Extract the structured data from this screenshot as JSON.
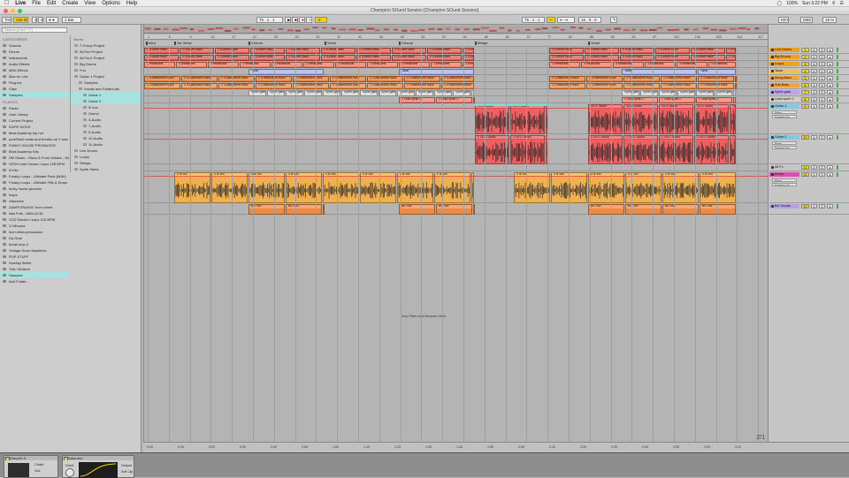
{
  "menubar": {
    "app": "Live",
    "items": [
      "File",
      "Edit",
      "Create",
      "View",
      "Options",
      "Help"
    ],
    "battery": "100%",
    "clock": "Sun 3:22 PM"
  },
  "window": {
    "title": "Champion SOund Session  [Champion SOund Session]"
  },
  "transport": {
    "tap": "TAP",
    "tempo": "150.00",
    "meter_a": "4",
    "meter_b": "4",
    "quantize": "1 Bar",
    "position": "75 .  1 .  1",
    "loop_start": "75 .  1 .  1",
    "loop_length": "16 .  0 .  0",
    "key": "KEY",
    "midi": "MIDI",
    "cpu": "19 %"
  },
  "browser": {
    "search_placeholder": "Search (Cmd + F)",
    "categories_header": "CATEGORIES",
    "categories": [
      "Sounds",
      "Drums",
      "Instruments",
      "Audio Effects",
      "MIDI Effects",
      "Max for Live",
      "Plug-ins",
      "Clips",
      "Samples"
    ],
    "places_header": "PLACES",
    "places": [
      "Packs",
      "User Library",
      "Current Project",
      "DOPE KICKS",
      "Beat Academy hip hot",
      "pureSteel beats and breaks vol 1 wav",
      "FUNKY HOUSE PRODUCER",
      "Beat Academy Kits",
      "SM Studio - Disco & Funk Guitars - WAV",
      "VESH Latin House Loops 128 BPM",
      "Ill Kitz",
      "Freaky Loops - Ultimate Pack [WAV]",
      "Freaky Loops - Ultimate Fills & Drops",
      "funky house grooves",
      "loops",
      "villacorbe",
      "ZAMPLEMASIC from robert",
      "Nas Folk - WAV-ACID",
      "VOZ Electric Loops 120 BPM",
      "G Minuma",
      "tech vibes percussion",
      "Da Grail",
      "break loop 3",
      "Vintage Drum Machines",
      "POP STUFF",
      "Sunday Skillet",
      "This I Believe",
      "Samples",
      "Add Folder..."
    ],
    "files_header": "Name",
    "files": [
      "7-Group Project",
      "All Fun Project",
      "All Fun1 Project",
      "Big Drums",
      "Fun",
      "Guitar 1 Project",
      "Samples",
      "Vocals and Guitars.als",
      "Guitar 1",
      "Guitar 2",
      "Ill Vox",
      "Outro1",
      "4-Audio",
      "7-Audio",
      "9-Audio",
      "10-Audio",
      "11-Audio",
      "Live Drums",
      "Loops",
      "Strings",
      "Synth Stabs"
    ]
  },
  "arrangement": {
    "ruler": [
      "1",
      "5",
      "9",
      "13",
      "17",
      "21",
      "25",
      "29",
      "33",
      "37",
      "41",
      "45",
      "49",
      "53",
      "57",
      "61",
      "65",
      "69",
      "73",
      "77",
      "81",
      "85",
      "89",
      "93",
      "97",
      "101",
      "105",
      "109",
      "113",
      "117"
    ],
    "locators": [
      "Intro",
      "1st Verse",
      "Chorus",
      "Verse",
      "Chorus",
      "Bridge",
      "Verse"
    ],
    "time_ruler": [
      "0:00",
      "0:10",
      "0:20",
      "0:30",
      "0:40",
      "0:50",
      "1:00",
      "1:10",
      "1:20",
      "1:30",
      "1:40",
      "1:50",
      "2:00",
      "2:10",
      "2:20",
      "2:30",
      "2:40",
      "2:50",
      "3:00",
      "3:10"
    ],
    "drop_text": "Drop Files and Devices Here",
    "clip_labels": {
      "drums": "1 4-Drum Rack",
      "bigdrums": "2 3-Drum Rack",
      "loop": "3 breakBeat",
      "moog": "2 3-Instrument Rack",
      "tamb": "Tamb",
      "synth": "Synth gate",
      "lead": "1 Lead synth 2",
      "guitar1": "15 27 Audio",
      "guitar2": "1 15 27 Audio",
      "vox": "4 Ill Vox",
      "bgvox": "BG Vox"
    },
    "zoom": "2/1"
  },
  "mixer": {
    "tracks": [
      {
        "name": "Live Drums",
        "num": "1",
        "color": "#f0a020",
        "h": 7
      },
      {
        "name": "Big Drums",
        "num": "2",
        "color": "#f0a020",
        "h": 7
      },
      {
        "name": "Loop1",
        "num": "3",
        "color": "#f0a020",
        "h": 7
      },
      {
        "name": "Tamb",
        "num": "4",
        "color": "#e8c060",
        "h": 7
      },
      {
        "name": "Moog Bass",
        "num": "5",
        "color": "#f3a13c",
        "h": 7
      },
      {
        "name": "Sub Bass",
        "num": "6",
        "color": "#f3a13c",
        "h": 7
      },
      {
        "name": "Synth gate",
        "num": "7",
        "color": "#bba4e8",
        "h": 7
      },
      {
        "name": "Lead synth 2",
        "num": "8",
        "color": "#d0d0d0",
        "h": 7
      },
      {
        "name": "Guitar 1",
        "num": "9",
        "color": "#83c9e5",
        "h": 34
      },
      {
        "name": "Guitar 2",
        "num": "10",
        "color": "#83c9e5",
        "h": 33
      },
      {
        "name": "All Fx",
        "num": "11",
        "color": "#c6c6c6",
        "h": 7
      },
      {
        "name": "Ill Vox",
        "num": "12",
        "color": "#e04db0",
        "h": 35
      },
      {
        "name": "BG Vocals",
        "num": "13",
        "color": "#b6a0e6",
        "h": 12
      }
    ],
    "sub_in": "Mixer",
    "sub_out": "Speaker On",
    "returns": [
      {
        "name": "A Ping Pong",
        "num": "A"
      },
      {
        "name": "B Large Hall",
        "num": "B"
      },
      {
        "name": "C Long Dela",
        "num": "C"
      },
      {
        "name": "Master",
        "num": "M"
      }
    ]
  },
  "detail": {
    "devices": [
      {
        "name": "Abeynth 5",
        "label_a": "Chain",
        "label_b": "Out"
      },
      {
        "name": "Saturator",
        "label_a": "Drive",
        "label_b": "Output"
      }
    ],
    "extra": "Soft Clip"
  }
}
